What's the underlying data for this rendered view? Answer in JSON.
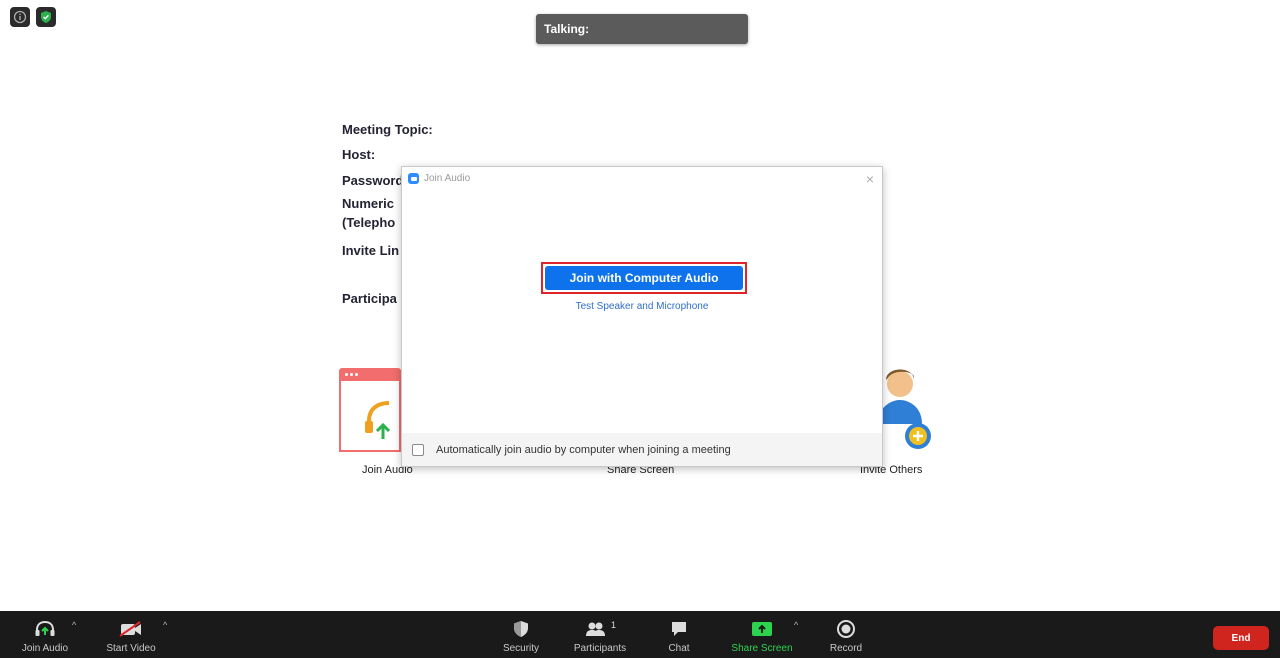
{
  "top": {
    "info_icon": "info-icon",
    "security_shield_icon": "shield-check-icon"
  },
  "talking": {
    "label": "Talking:"
  },
  "meeting_info": {
    "topic": "Meeting Topic:",
    "host": "Host:",
    "password": "Password",
    "numeric": "Numeric",
    "telephone": "(Telepho",
    "invite_link": "Invite Lin",
    "participant": "Participa"
  },
  "tiles": {
    "join_audio": "Join Audio",
    "share_screen": "Share Screen",
    "invite_others": "Invite Others"
  },
  "dialog": {
    "title": "Join Audio",
    "close": "×",
    "join_button": "Join with Computer Audio",
    "test_link": "Test Speaker and Microphone",
    "auto_join": "Automatically join audio by computer when joining a meeting"
  },
  "toolbar": {
    "join_audio": "Join Audio",
    "start_video": "Start Video",
    "security": "Security",
    "participants": "Participants",
    "participants_count": "1",
    "chat": "Chat",
    "share_screen": "Share Screen",
    "record": "Record",
    "caret": "^",
    "end": "End"
  },
  "colors": {
    "accent_blue": "#0e72ed",
    "end_red": "#d0241e",
    "share_green": "#2bd34f",
    "highlight_red": "#e0242c"
  }
}
